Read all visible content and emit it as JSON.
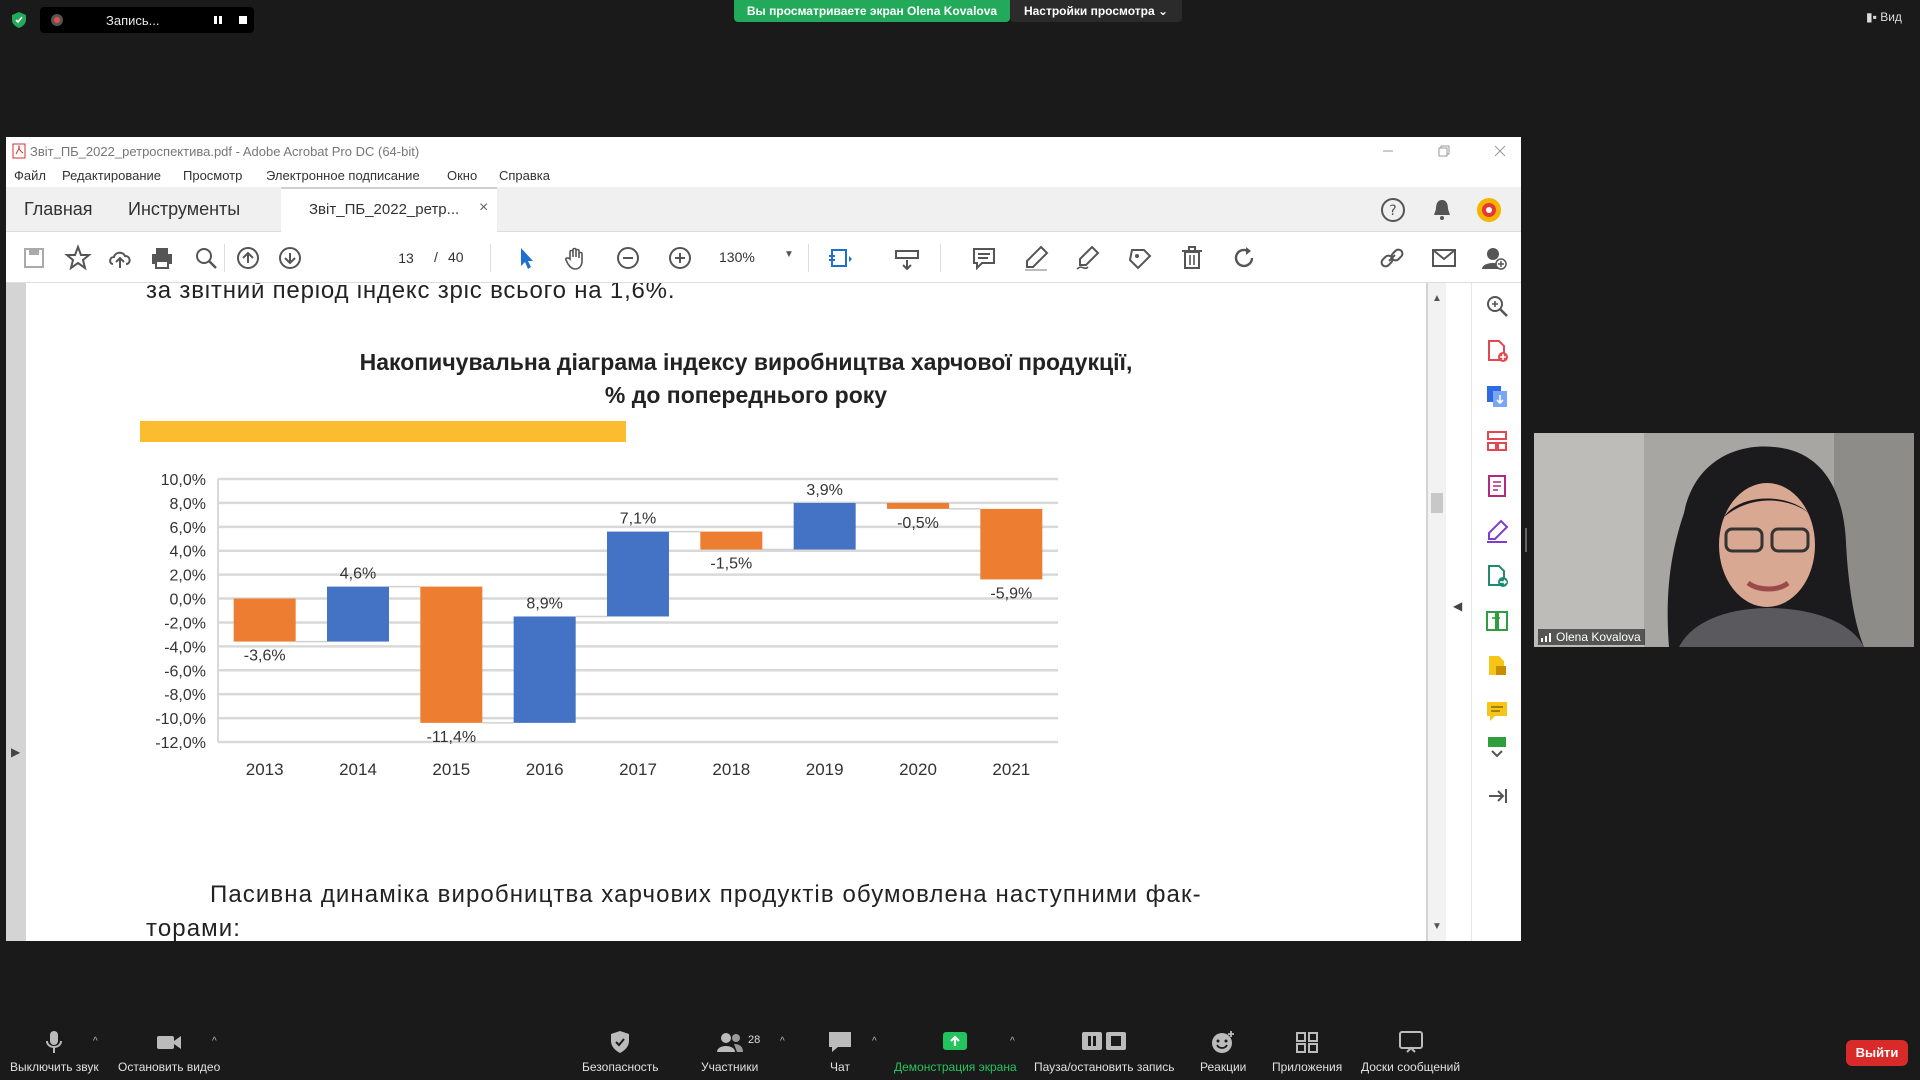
{
  "zoom": {
    "recording_label": "Запись...",
    "viewing_banner": "Вы просматриваете экран Olena Kovalova",
    "view_options": "Настройки просмотра ⌄",
    "view_button": "Вид",
    "participants_count": "28",
    "participant_name": "Olena Kovalova",
    "toolbar": {
      "mute": "Выключить звук",
      "stop_video": "Остановить видео",
      "security": "Безопасность",
      "participants": "Участники",
      "chat": "Чат",
      "share_screen": "Демонстрация экрана",
      "pause_recording": "Пауза/остановить запись",
      "reactions": "Реакции",
      "apps": "Приложения",
      "whiteboards": "Доски сообщений",
      "leave": "Выйти"
    }
  },
  "acrobat": {
    "window_title": "Звіт_ПБ_2022_ретроспектива.pdf - Adobe Acrobat Pro DC (64-bit)",
    "menu": [
      "Файл",
      "Редактирование",
      "Просмотр",
      "Электронное подписание",
      "Окно",
      "Справка"
    ],
    "tabs": {
      "home": "Главная",
      "tools": "Инструменты",
      "document": "Звіт_ПБ_2022_ретр..."
    },
    "page_current": "13",
    "page_separator": "/",
    "page_total": "40",
    "zoom": "130%"
  },
  "document": {
    "prev_text": "за звітний період індекс зріс всього на 1,6%.",
    "chart_title_line1": "Накопичувальна діаграма індексу виробництва харчової продукції,",
    "chart_title_line2": "% до попереднього року",
    "next_text_line1": "Пасивна динаміка виробництва харчових продуктів обумовлена наступними фак-",
    "next_text_line2": "торами:"
  },
  "chart_data": {
    "type": "bar",
    "subtype": "waterfall",
    "categories": [
      "2013",
      "2014",
      "2015",
      "2016",
      "2017",
      "2018",
      "2019",
      "2020",
      "2021"
    ],
    "values": [
      -3.6,
      4.6,
      -11.4,
      8.9,
      7.1,
      -1.5,
      3.9,
      -0.5,
      -5.9
    ],
    "labels": [
      "-3,6%",
      "4,6%",
      "-11,4%",
      "8,9%",
      "7,1%",
      "-1,5%",
      "3,9%",
      "-0,5%",
      "-5,9%"
    ],
    "ylim": [
      -12,
      10
    ],
    "yticks": [
      "10,0%",
      "8,0%",
      "6,0%",
      "4,0%",
      "2,0%",
      "0,0%",
      "-2,0%",
      "-4,0%",
      "-6,0%",
      "-8,0%",
      "-10,0%",
      "-12,0%"
    ],
    "ytick_values": [
      10,
      8,
      6,
      4,
      2,
      0,
      -2,
      -4,
      -6,
      -8,
      -10,
      -12
    ],
    "colors": {
      "increase": "#4472c4",
      "decrease": "#ed7d31",
      "grid": "#d9d9d9",
      "accent": "#fbbd2f"
    },
    "grid": true,
    "legend": "none"
  }
}
